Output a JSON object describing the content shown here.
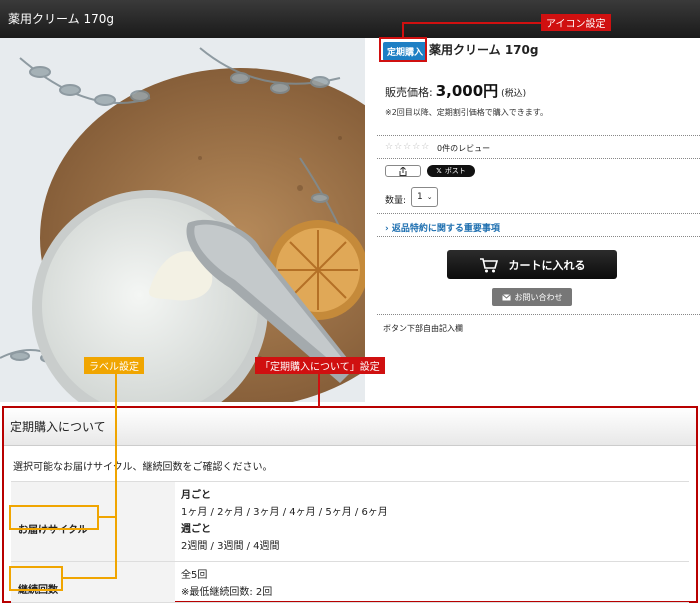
{
  "header": {
    "title": "薬用クリーム 170g"
  },
  "product": {
    "badge": "定期購入",
    "title": "薬用クリーム 170g",
    "price_label": "販売価格:",
    "price": "3,000円",
    "price_tax": "(税込)",
    "price_note": "※2回目以降、定期割引価格で購入できます。",
    "stars": "☆☆☆☆☆",
    "review_count": "0件のレビュー",
    "share_icon": "share-icon",
    "x_post": "ポスト",
    "qty_label": "数量:",
    "qty_value": "1",
    "notice_link": "返品特約に関する重要事項",
    "cart_button": "カートに入れる",
    "inquiry_button": "お問い合わせ",
    "free_text": "ボタン下部自由記入欄"
  },
  "annotations": {
    "icon_setting": "アイコン設定",
    "label_setting": "ラベル設定",
    "about_setting": "「定期購入について」設定"
  },
  "subscription": {
    "heading": "定期購入について",
    "intro": "選択可能なお届けサイクル、継続回数をご確認ください。",
    "rows": [
      {
        "label": "お届けサイクル",
        "lines": [
          "月ごと",
          "1ヶ月 / 2ヶ月 / 3ヶ月 / 4ヶ月 / 5ヶ月 / 6ヶ月",
          "週ごと",
          "2週間 / 3週間 / 4週間"
        ]
      },
      {
        "label": "継続回数",
        "lines": [
          "全5回",
          "※最低継続回数: 2回"
        ]
      }
    ]
  },
  "colors": {
    "accent_red": "#d01010",
    "accent_orange": "#f0a500",
    "badge_blue": "#1e7fc4",
    "link_blue": "#1e6fb0"
  }
}
